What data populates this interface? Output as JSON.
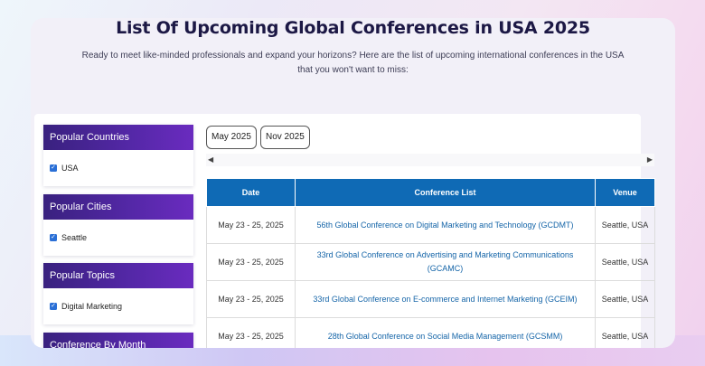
{
  "header": {
    "title": "List Of Upcoming Global Conferences in USA 2025",
    "subtitle": "Ready to meet like-minded professionals and expand your horizons? Here are the list of upcoming international conferences in the USA that you won't want to miss:"
  },
  "sidebar": {
    "widgets": [
      {
        "title": "Popular Countries",
        "item": "USA"
      },
      {
        "title": "Popular Cities",
        "item": "Seattle"
      },
      {
        "title": "Popular Topics",
        "item": "Digital Marketing"
      },
      {
        "title": "Conference By Month"
      }
    ]
  },
  "months": [
    "May 2025",
    "Nov 2025"
  ],
  "table": {
    "headers": [
      "Date",
      "Conference List",
      "Venue"
    ],
    "rows": [
      {
        "date": "May 23 - 25, 2025",
        "name": "56th Global Conference on Digital Marketing and Technology (GCDMT)",
        "venue": "Seattle, USA"
      },
      {
        "date": "May 23 - 25, 2025",
        "name": "33rd Global Conference on Advertising and Marketing Communications (GCAMC)",
        "venue": "Seattle, USA"
      },
      {
        "date": "May 23 - 25, 2025",
        "name": "33rd Global Conference on E-commerce and Internet Marketing (GCEIM)",
        "venue": "Seattle, USA"
      },
      {
        "date": "May 23 - 25, 2025",
        "name": "28th Global Conference on Social Media Management (GCSMM)",
        "venue": "Seattle, USA"
      }
    ]
  },
  "icons": {
    "checkbox": "checkmark-icon",
    "scroll_left": "arrow-left-icon",
    "scroll_right": "arrow-right-icon"
  },
  "colors": {
    "widget_header": "#4a23a0",
    "table_header": "#0f6ab5",
    "link": "#1565a8",
    "checkbox": "#2a6fd6"
  }
}
